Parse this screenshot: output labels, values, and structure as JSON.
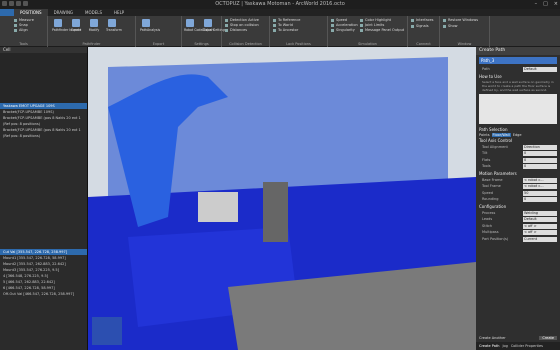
{
  "window": {
    "title": "OCTOPUZ | Yaskawa Motoman - ArcWorld 2016.octo"
  },
  "tabs": [
    "",
    "POSITIONS",
    "DRAWING",
    "MODELS",
    "HELP"
  ],
  "ribbon": {
    "tools": {
      "label": "Tools",
      "items": [
        "Measure",
        "Snap",
        "Align"
      ]
    },
    "path": {
      "label": "PathFinder",
      "items": [
        "Pathfinder Inspect",
        "Create",
        "Modify",
        "Transform",
        "Pathfinder",
        "PathAnalysis",
        "Robot Code Export",
        "Global Settings"
      ]
    },
    "export": {
      "label": "Export",
      "items": []
    },
    "settings": {
      "label": "Settings",
      "items": []
    },
    "collision": {
      "label": "Collision Detection",
      "items": [
        "Detection Active",
        "Stop on collision",
        "Distances"
      ]
    },
    "lock": {
      "label": "Lock Positions",
      "items": [
        "To Reference",
        "To World",
        "To Ancestor"
      ]
    },
    "simulation": {
      "label": "Simulation",
      "items": [
        "Speed",
        "Acceleration",
        "Singularity",
        "Color Highlight",
        "Joint Limits",
        "Message Panel Output"
      ]
    },
    "connect": {
      "label": "Connect",
      "items": [
        "Interfaces",
        "Signals"
      ]
    },
    "window": {
      "label": "Window",
      "items": [
        "Restore Windows",
        "Show"
      ]
    }
  },
  "left_panel": {
    "title": "Cell",
    "rows": [
      "Yaskawa EMOT UPGAGE 109S",
      "Bracket(FCP-UPSAMBE 109S)",
      "Bracket(FCP-UPSAMBE (pos 8 Nakls 20 ext 1",
      "(Ref pos: 8 positions)",
      "Bracket(FCP-UPSAMBE (pos 8 Nakls 20 ext 1",
      "(Ref pos: 8 positions)"
    ],
    "lower_rows": [
      "Cut Val [355.547, 226.728, 258.997]",
      "Mount1 [355.547, 226.728, 58.997]",
      "Mount2 [355.547, 262.883, 22.642]",
      "Mount3 [355.547, 276.225, 9.5]",
      "4 [366.548, 276.225, 9.5]",
      "5 [466.547, 262.883, 22.642]",
      "6 [466.547, 226.728, 58.997]",
      "Off-Out Val [466.547, 226.728, 258.997]"
    ]
  },
  "right_panel": {
    "title": "Create Path",
    "path_name": "Path_3",
    "path_label": "Path",
    "path_value": "Default",
    "how_to": "How to Use",
    "howto_text": "Select a face and a wall surface on geometry in the world to create a path the floor surface is defined by, and the wall surface as second.",
    "path_selection": "Path Selection",
    "selection_modes": [
      "Points",
      "Floor/Wall",
      "Edge"
    ],
    "tool_axis": {
      "title": "Tool Axis Control",
      "rows": [
        [
          "Tool Alignment",
          "Direction"
        ],
        [
          "Tilt",
          "0"
        ],
        [
          "Flats",
          "0"
        ],
        [
          "Tools",
          "0"
        ]
      ]
    },
    "motion": {
      "title": "Motion Parameters",
      "rows": [
        [
          "Base Frame",
          "< robot c..."
        ],
        [
          "Tool Frame",
          "< robot c..."
        ],
        [
          "Speed",
          "50"
        ],
        [
          "Rounding",
          "0"
        ]
      ]
    },
    "configuration": {
      "title": "Configuration",
      "rows": [
        [
          "Process",
          "Welding"
        ],
        [
          "Leads",
          "Default"
        ],
        [
          "Stitch",
          "< off >"
        ],
        [
          "Multipass",
          "< off >"
        ],
        [
          "Part Position(s)",
          "Current"
        ]
      ]
    },
    "create_another": "Create Another",
    "create_btn": "Create",
    "bottom_tabs": [
      "Create Path",
      "Jog",
      "Collider Properties"
    ]
  },
  "colors": {
    "accent": "#2d6aad",
    "robot": "#1e5fd6",
    "cell_blue": "#1a2fc9"
  }
}
